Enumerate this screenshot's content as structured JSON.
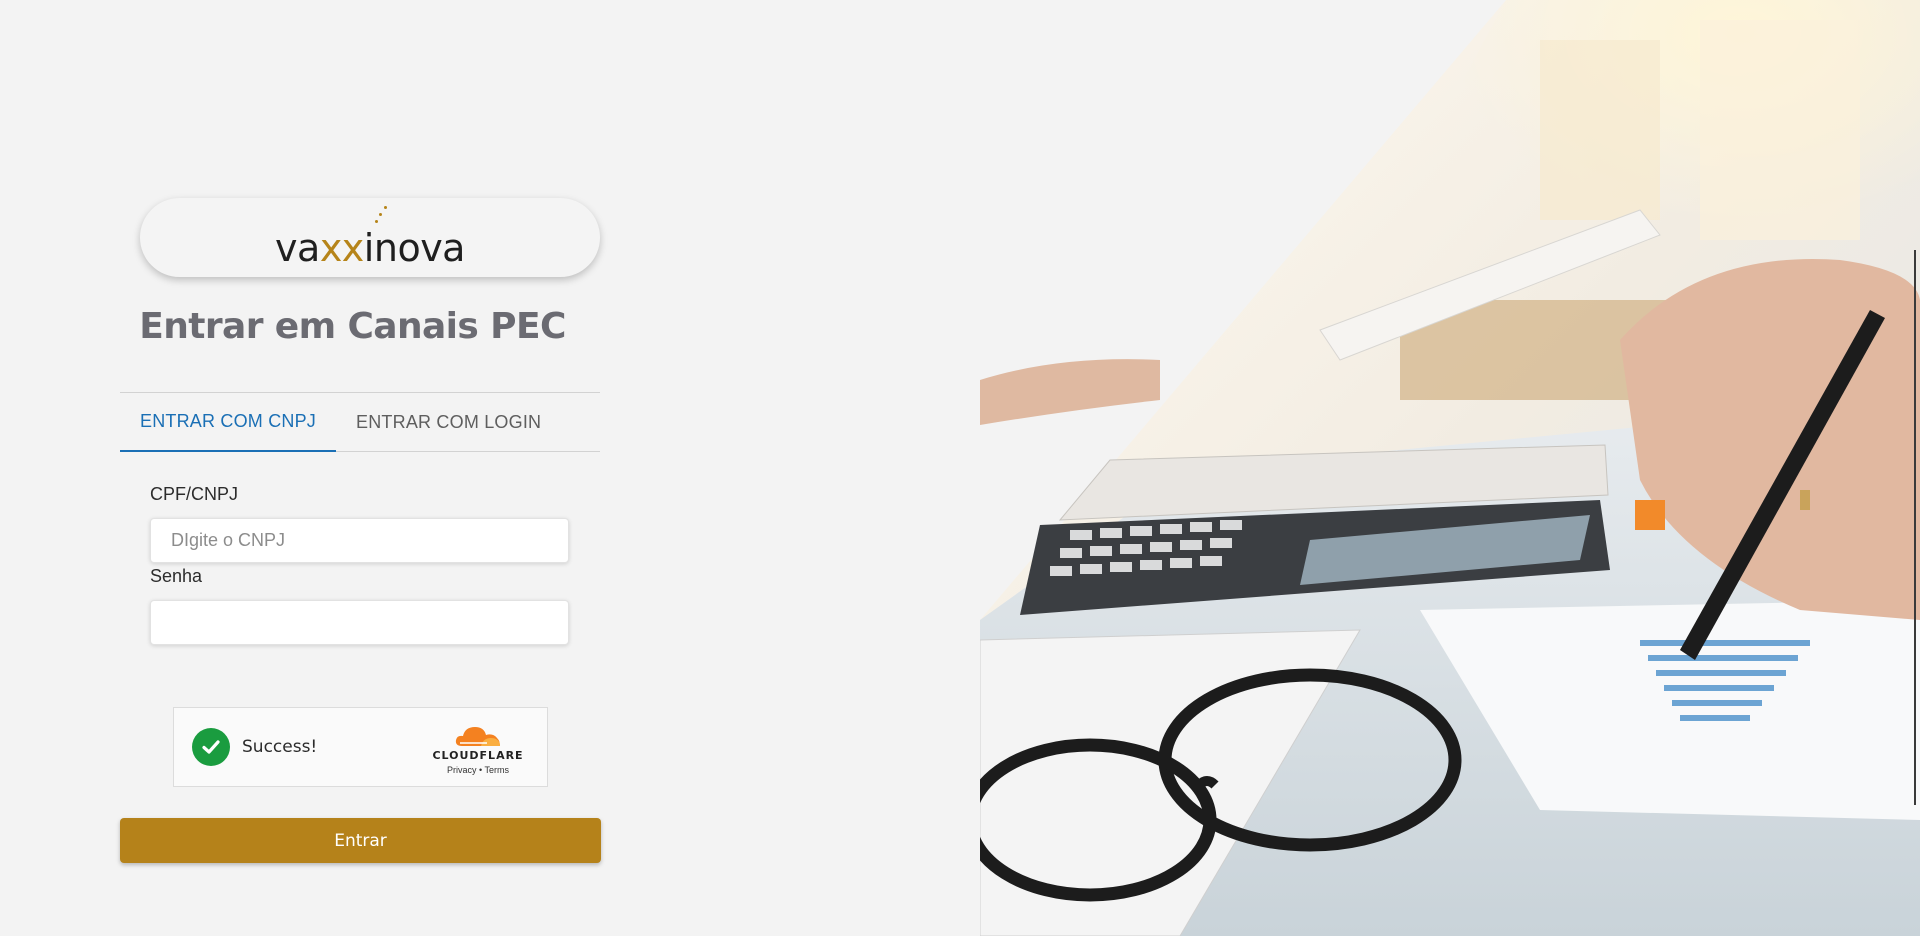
{
  "brand": {
    "logo_prefix": "va",
    "logo_x": "xx",
    "logo_suffix": "inova",
    "accent_color": "#b5821a"
  },
  "page_title": "Entrar em Canais PEC",
  "tabs": [
    {
      "label": "ENTRAR COM CNPJ",
      "active": true
    },
    {
      "label": "ENTRAR COM LOGIN",
      "active": false
    }
  ],
  "form": {
    "cnpj_label": "CPF/CNPJ",
    "cnpj_placeholder": "DIgite o CNPJ",
    "cnpj_value": "",
    "password_label": "Senha",
    "password_value": ""
  },
  "captcha": {
    "status": "Success!",
    "provider": "CLOUDFLARE",
    "privacy_link": "Privacy",
    "separator": "•",
    "terms_link": "Terms",
    "icon": "check-circle-icon"
  },
  "submit_label": "Entrar",
  "hero_image": "office-desk-calculator-glasses-photo",
  "colors": {
    "tab_active": "#1a6fb5",
    "success_green": "#1a9c3f",
    "background": "#f3f3f3"
  }
}
